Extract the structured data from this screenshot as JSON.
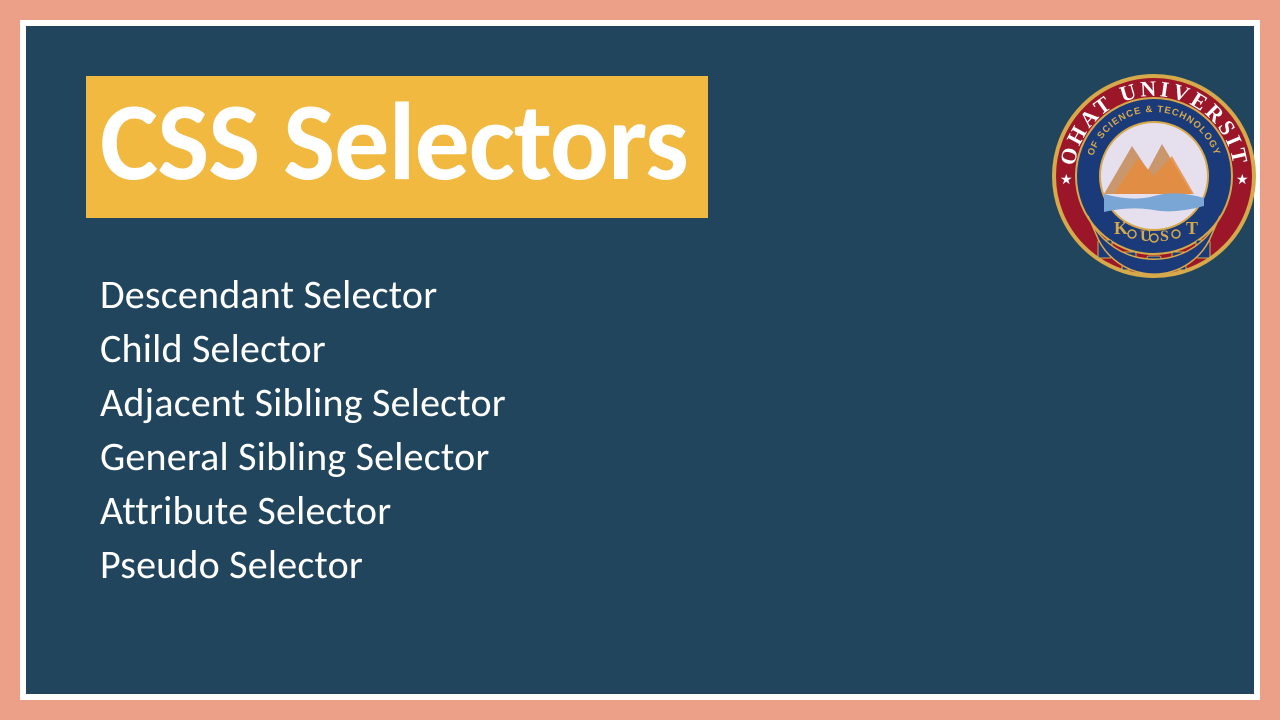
{
  "title": "CSS Selectors",
  "items": [
    "Descendant Selector",
    "Child Selector",
    "Adjacent Sibling Selector",
    "General Sibling Selector",
    "Attribute Selector",
    "Pseudo Selector"
  ],
  "logo": {
    "outer_text": "KOHAT UNIVERSITY",
    "inner_text": "OF SCIENCE & TECHNOLOGY",
    "initials": [
      "K",
      "U",
      "S",
      "T"
    ]
  },
  "colors": {
    "frame_bg": "#eca088",
    "slide_bg": "#21455d",
    "title_bg": "#f2b941",
    "text": "#ffffff",
    "logo_red": "#9c162a",
    "logo_blue": "#1a3a7a",
    "logo_orange": "#e78b3a",
    "logo_gold": "#d6a94a"
  }
}
